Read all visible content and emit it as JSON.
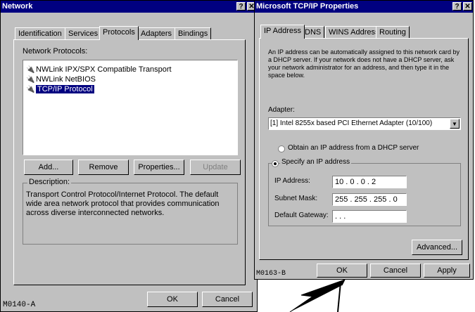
{
  "network": {
    "title": "Network",
    "help_btn": "?",
    "close_btn": "✕",
    "tabs": [
      "Identification",
      "Services",
      "Protocols",
      "Adapters",
      "Bindings"
    ],
    "protocols_label": "Network Protocols:",
    "protocols": [
      {
        "label": "NWLink IPX/SPX Compatible Transport",
        "icon": "network-protocol-icon"
      },
      {
        "label": "NWLink NetBIOS",
        "icon": "network-protocol-icon"
      },
      {
        "label": "TCP/IP Protocol",
        "icon": "network-protocol-icon",
        "selected": true
      }
    ],
    "buttons": {
      "add": "Add...",
      "remove": "Remove",
      "properties": "Properties...",
      "update": "Update"
    },
    "description_label": "Description:",
    "description_text": "Transport Control Protocol/Internet Protocol. The default wide area network protocol that provides communication across diverse interconnected networks.",
    "ok": "OK",
    "cancel": "Cancel",
    "figure_code": "M0140-A"
  },
  "tcpip": {
    "title": "Microsoft TCP/IP Properties",
    "help_btn": "?",
    "close_btn": "✕",
    "tabs": [
      "IP Address",
      "DNS",
      "WINS Address",
      "Routing"
    ],
    "intro": "An IP address can be automatically assigned to this network card by a DHCP server. If your network does not have a DHCP server, ask your network administrator for an address, and then type it in the space below.",
    "adapter_label": "Adapter:",
    "adapter_value": "[1] Intel 8255x based PCI Ethernet Adapter (10/100)",
    "radio_dhcp": "Obtain an IP address from a DHCP server",
    "radio_specify": "Specify an IP address",
    "ip_label": "IP Address:",
    "ip_value": "10 . 0 . 0 . 2",
    "subnet_label": "Subnet Mask:",
    "subnet_value": "255 . 255 . 255 . 0",
    "gateway_label": "Default Gateway:",
    "gateway_value": ". . .",
    "advanced": "Advanced...",
    "ok": "OK",
    "cancel": "Cancel",
    "apply": "Apply",
    "figure_code": "M0163-B"
  }
}
